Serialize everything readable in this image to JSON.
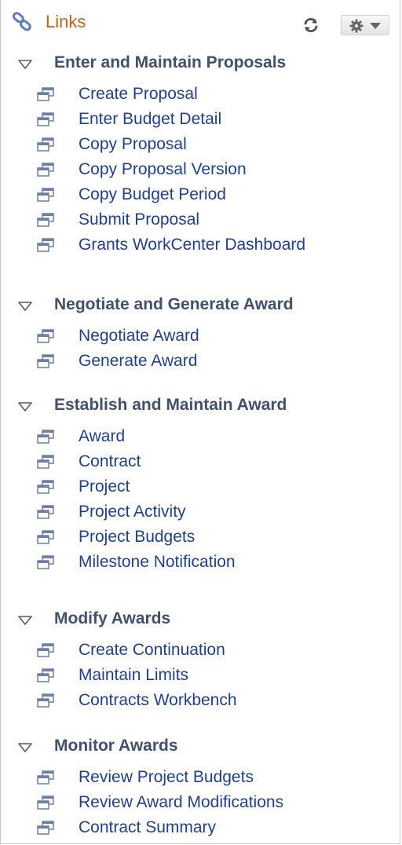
{
  "header": {
    "title": "Links",
    "icons": {
      "title": "links-icon",
      "refresh": "refresh-icon",
      "settings": "gear-icon"
    }
  },
  "colors": {
    "title": "#c2611a",
    "group_title": "#40506e",
    "link": "#1f3f8f",
    "icon": "#6b7fa8"
  },
  "groups": [
    {
      "title": "Enter and Maintain Proposals",
      "links": [
        "Create Proposal",
        "Enter Budget Detail",
        "Copy Proposal",
        "Copy Proposal Version",
        "Copy Budget Period",
        "Submit Proposal",
        "Grants WorkCenter Dashboard"
      ]
    },
    {
      "title": "Negotiate and Generate Award",
      "links": [
        "Negotiate Award",
        "Generate Award"
      ]
    },
    {
      "title": "Establish and Maintain Award",
      "links": [
        "Award",
        "Contract",
        "Project",
        "Project Activity",
        "Project Budgets",
        "Milestone Notification"
      ]
    },
    {
      "title": "Modify Awards",
      "links": [
        "Create Continuation",
        "Maintain Limits",
        "Contracts Workbench"
      ]
    },
    {
      "title": "Monitor Awards",
      "links": [
        "Review Project Budgets",
        "Review Award Modifications",
        "Contract Summary"
      ]
    }
  ]
}
